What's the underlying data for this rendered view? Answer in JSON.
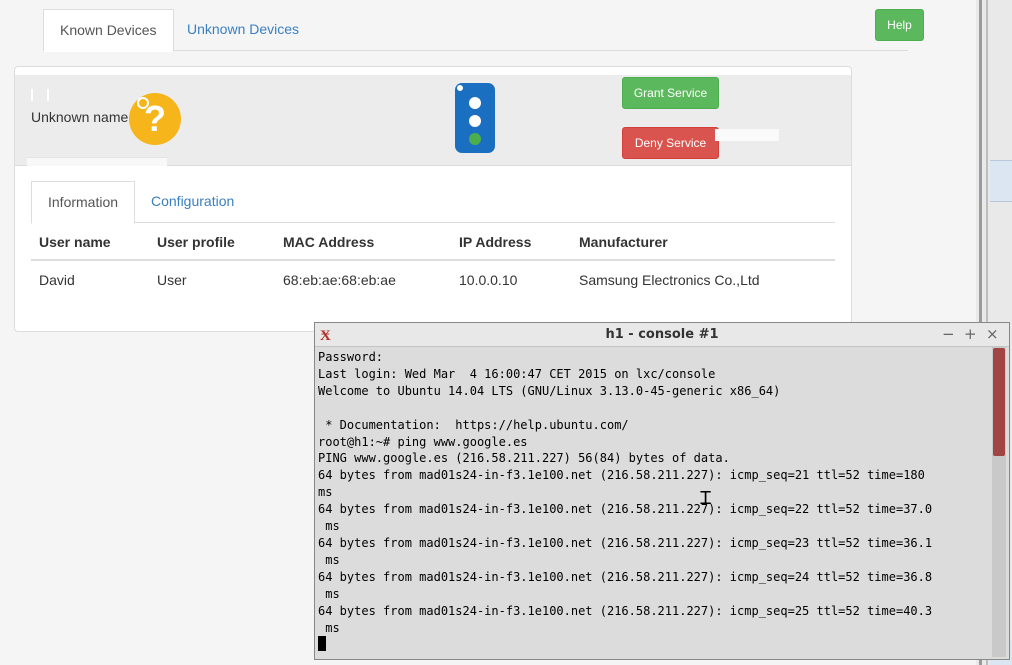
{
  "top_tabs": {
    "known": "Known Devices",
    "unknown": "Unknown Devices"
  },
  "help_label": "Help",
  "device": {
    "name": "Unknown name",
    "grant_label": "Grant Service",
    "deny_label": "Deny Service"
  },
  "inner_tabs": {
    "information": "Information",
    "configuration": "Configuration"
  },
  "table": {
    "headers": [
      "User name",
      "User profile",
      "MAC Address",
      "IP Address",
      "Manufacturer"
    ],
    "rows": [
      [
        "David",
        "User",
        "68:eb:ae:68:eb:ae",
        "10.0.0.10",
        "Samsung Electronics Co.,Ltd"
      ]
    ]
  },
  "terminal": {
    "title": "h1 - console #1",
    "controls": [
      "−",
      "+",
      "×"
    ],
    "lines": [
      "Password:",
      "Last login: Wed Mar  4 16:00:47 CET 2015 on lxc/console",
      "Welcome to Ubuntu 14.04 LTS (GNU/Linux 3.13.0-45-generic x86_64)",
      "",
      " * Documentation:  https://help.ubuntu.com/",
      "root@h1:~# ping www.google.es",
      "PING www.google.es (216.58.211.227) 56(84) bytes of data.",
      "64 bytes from mad01s24-in-f3.1e100.net (216.58.211.227): icmp_seq=21 ttl=52 time=180",
      "ms",
      "64 bytes from mad01s24-in-f3.1e100.net (216.58.211.227): icmp_seq=22 ttl=52 time=37.0",
      " ms",
      "64 bytes from mad01s24-in-f3.1e100.net (216.58.211.227): icmp_seq=23 ttl=52 time=36.1",
      " ms",
      "64 bytes from mad01s24-in-f3.1e100.net (216.58.211.227): icmp_seq=24 ttl=52 time=36.8",
      " ms",
      "64 bytes from mad01s24-in-f3.1e100.net (216.58.211.227): icmp_seq=25 ttl=52 time=40.3",
      " ms"
    ]
  }
}
